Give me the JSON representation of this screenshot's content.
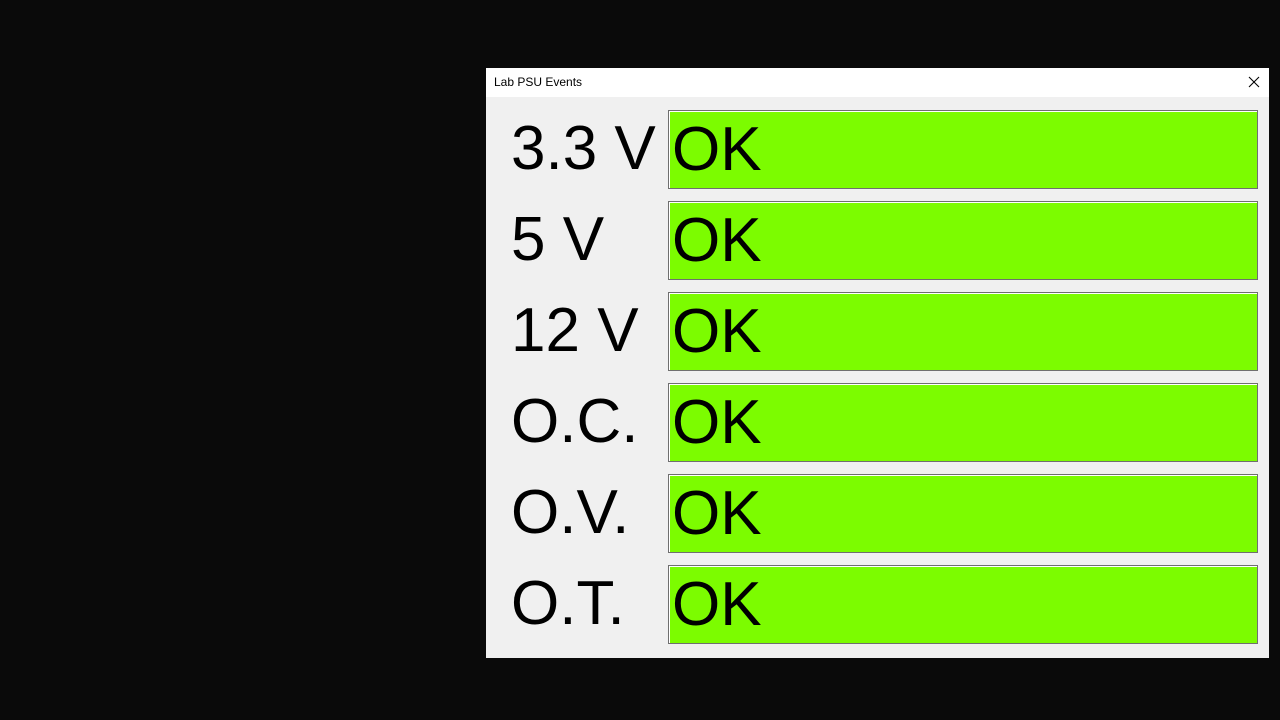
{
  "window": {
    "title": "Lab PSU Events"
  },
  "colors": {
    "ok": "#7cfc00",
    "desktop": "#0a0a0a",
    "window_bg": "#f0f0f0"
  },
  "icons": {
    "close": "close-icon"
  },
  "events": [
    {
      "label": "3.3 V",
      "status": "OK"
    },
    {
      "label": "5 V",
      "status": "OK"
    },
    {
      "label": "12 V",
      "status": "OK"
    },
    {
      "label": "O.C.",
      "status": "OK"
    },
    {
      "label": "O.V.",
      "status": "OK"
    },
    {
      "label": "O.T.",
      "status": "OK"
    }
  ]
}
